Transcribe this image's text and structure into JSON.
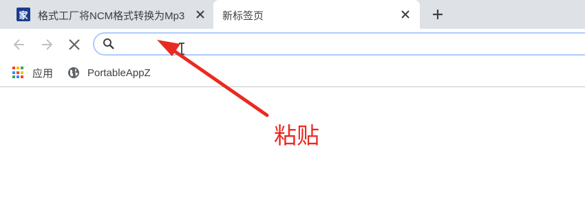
{
  "tabs": [
    {
      "favicon_text": "家",
      "title": "格式工厂将NCM格式转换为Mp3",
      "close_label": "✕"
    },
    {
      "title": "新标签页",
      "close_label": "✕"
    }
  ],
  "new_tab_label": "+",
  "nav": {
    "back_icon": "arrow-left-icon",
    "forward_icon": "arrow-right-icon",
    "stop_icon": "close-icon"
  },
  "omnibox": {
    "value": "",
    "placeholder": "",
    "icon": "search-icon"
  },
  "bookmarks": [
    {
      "label": "应用",
      "icon": "apps-grid-icon"
    },
    {
      "label": "PortableAppZ",
      "icon": "globe-icon"
    }
  ],
  "annotation": {
    "text": "粘贴",
    "color": "#ea2a21"
  },
  "colors": {
    "tab_strip": "#dee1e6",
    "active_tab": "#ffffff",
    "omnibox_border": "#aecbfa",
    "apps_dots": [
      "#ea4335",
      "#fbbc04",
      "#34a853",
      "#4285f4",
      "#ea4335",
      "#fbbc04",
      "#34a853",
      "#4285f4",
      "#ea4335"
    ]
  }
}
